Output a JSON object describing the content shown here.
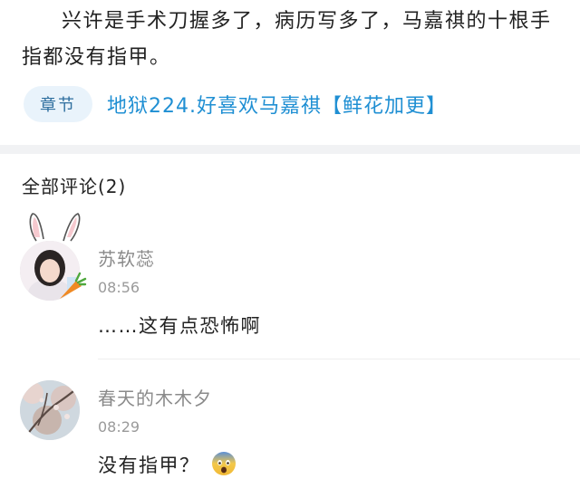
{
  "story": {
    "text": "兴许是手术刀握多了，病历写多了，马嘉祺的十根手指都没有指甲。",
    "chapter_tag": "章节",
    "chapter_title": "地狱224.好喜欢马嘉祺【鲜花加更】"
  },
  "comments_header": {
    "title": "全部评论(2)"
  },
  "comments": [
    {
      "username": "苏软蕊",
      "time": "08:56",
      "content": "……这有点恐怖啊"
    },
    {
      "username": "春天的木木夕",
      "time": "08:29",
      "content": "没有指甲？",
      "emoji": "fearful-face"
    }
  ],
  "colors": {
    "link": "#1f8fd3",
    "tag_bg": "#e9f3fb",
    "meta": "#8a8a8a",
    "divider": "#f1f2f4"
  }
}
